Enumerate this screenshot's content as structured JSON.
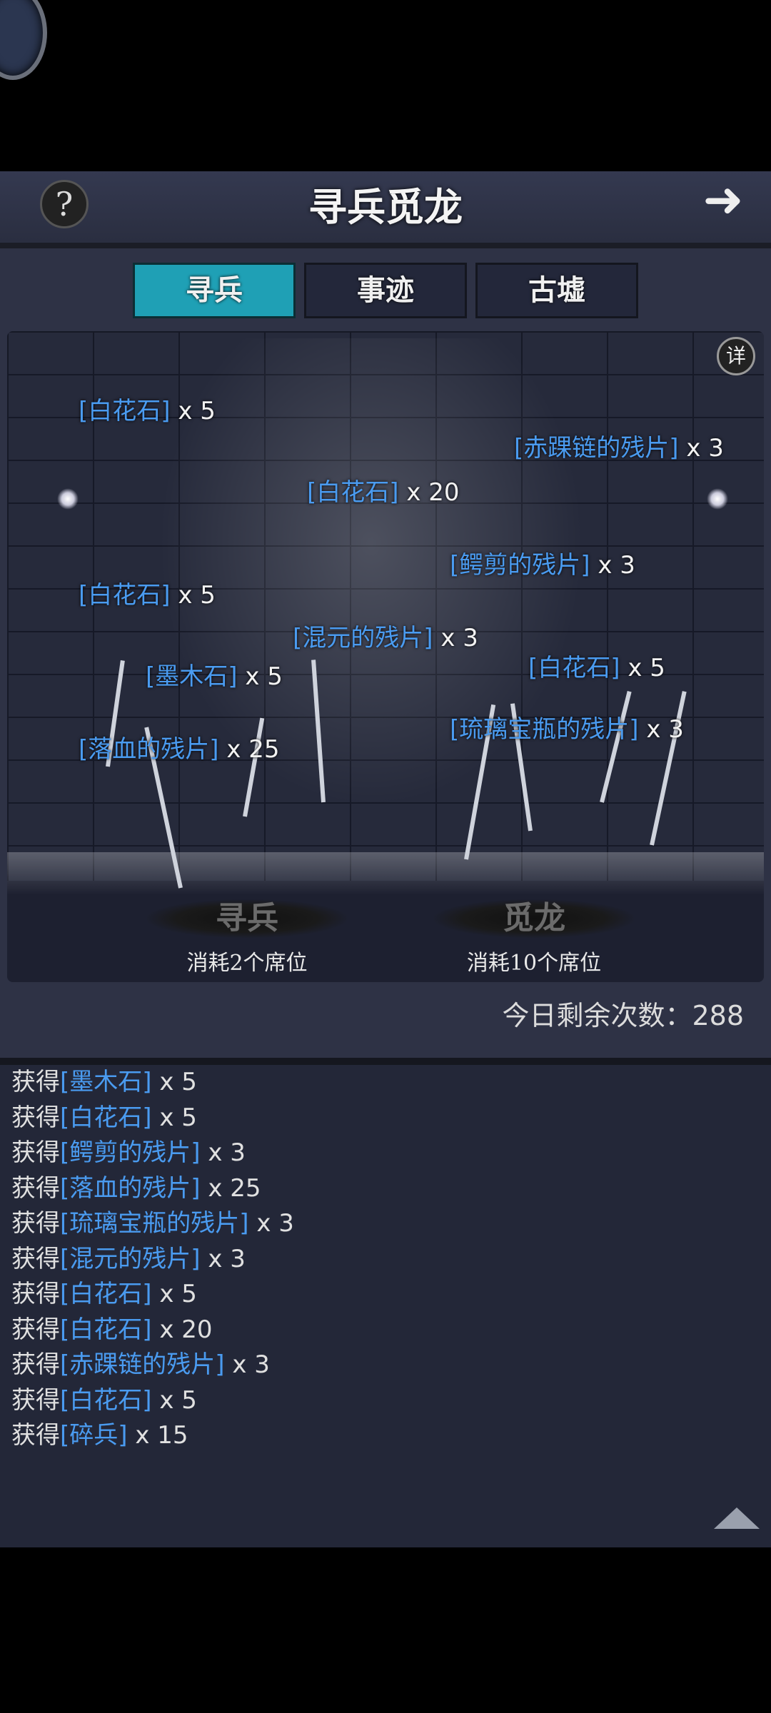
{
  "header": {
    "help_icon": "?",
    "title": "寻兵觅龙",
    "forward_icon": "➜"
  },
  "tabs": [
    {
      "label": "寻兵",
      "active": true
    },
    {
      "label": "事迹",
      "active": false
    },
    {
      "label": "古墟",
      "active": false
    }
  ],
  "stage": {
    "info_label": "详",
    "loot": [
      {
        "name": "[白花石]",
        "qty": " x 5"
      },
      {
        "name": "[赤踝链的残片]",
        "qty": " x 3"
      },
      {
        "name": "[白花石]",
        "qty": " x 20"
      },
      {
        "name": "[鳄剪的残片]",
        "qty": " x 3"
      },
      {
        "name": "[白花石]",
        "qty": " x 5"
      },
      {
        "name": "[混元的残片]",
        "qty": " x 3"
      },
      {
        "name": "[墨木石]",
        "qty": " x 5"
      },
      {
        "name": "[白花石]",
        "qty": " x 5"
      },
      {
        "name": "[琉璃宝瓶的残片]",
        "qty": " x 3"
      },
      {
        "name": "[落血的残片]",
        "qty": " x 25"
      }
    ],
    "actions": [
      {
        "label": "寻兵",
        "cost": "消耗2个席位"
      },
      {
        "label": "觅龙",
        "cost": "消耗10个席位"
      }
    ]
  },
  "remaining_text": "今日剩余次数：288",
  "log": {
    "prefix": "获得",
    "items": [
      {
        "name": "[墨木石]",
        "qty": " x 5"
      },
      {
        "name": "[白花石]",
        "qty": " x 5"
      },
      {
        "name": "[鳄剪的残片]",
        "qty": " x 3"
      },
      {
        "name": "[落血的残片]",
        "qty": " x 25"
      },
      {
        "name": "[琉璃宝瓶的残片]",
        "qty": " x 3"
      },
      {
        "name": "[混元的残片]",
        "qty": " x 3"
      },
      {
        "name": "[白花石]",
        "qty": " x 5"
      },
      {
        "name": "[白花石]",
        "qty": " x 20"
      },
      {
        "name": "[赤踝链的残片]",
        "qty": " x 3"
      },
      {
        "name": "[白花石]",
        "qty": " x 5"
      },
      {
        "name": "[碎兵]",
        "qty": " x 15"
      }
    ]
  },
  "colors": {
    "item_name": "#4a9bf0",
    "active_tab": "#1fa0b5",
    "panel_bg": "#2e3245"
  }
}
